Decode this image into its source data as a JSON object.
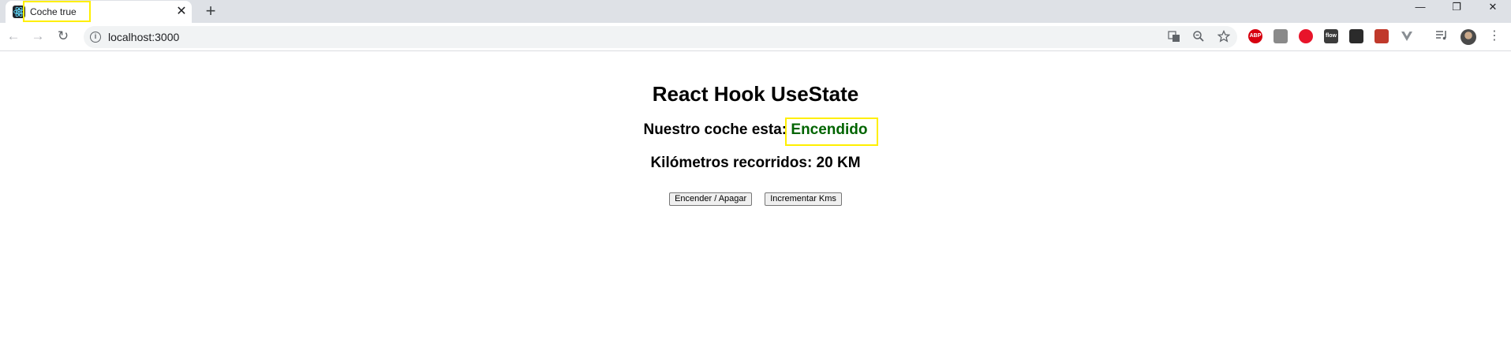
{
  "browser": {
    "tab": {
      "title": "Coche true",
      "close_glyph": "✕",
      "favicon": "react-icon"
    },
    "new_tab_glyph": "+",
    "window_controls": {
      "minimize": "—",
      "restore": "❐",
      "close": "✕"
    },
    "nav": {
      "back": "←",
      "forward": "→",
      "reload": "↻"
    },
    "address": {
      "url": "localhost:3000",
      "info_glyph": "i"
    },
    "omnibox_icons": [
      "translate-icon",
      "zoom-icon",
      "bookmark-star-icon"
    ],
    "extensions": [
      {
        "name": "adblock-plus-icon",
        "label": "ABP",
        "color": "#d7000f"
      },
      {
        "name": "pdf-icon",
        "label": "",
        "color": "#8a8a8a"
      },
      {
        "name": "stop-sign-icon",
        "label": "",
        "color": "#e8142a"
      },
      {
        "name": "flow-extension-icon",
        "label": "flow",
        "color": "#3c3c3c"
      },
      {
        "name": "dark-extension-icon",
        "label": "",
        "color": "#2b2b2b"
      },
      {
        "name": "red-extension-icon",
        "label": "",
        "color": "#c0392b"
      },
      {
        "name": "vue-devtools-icon",
        "label": "",
        "color": "#8a8f94"
      }
    ]
  },
  "page": {
    "title": "React Hook UseState",
    "status_prefix": "Nuestro coche esta: ",
    "status_value": "Encendido",
    "km_text": "Kilómetros recorridos: 20 KM",
    "buttons": {
      "toggle": "Encender / Apagar",
      "increment": "Incrementar Kms"
    }
  },
  "colors": {
    "status_on": "#006400",
    "highlight_box": "#ffef00"
  }
}
